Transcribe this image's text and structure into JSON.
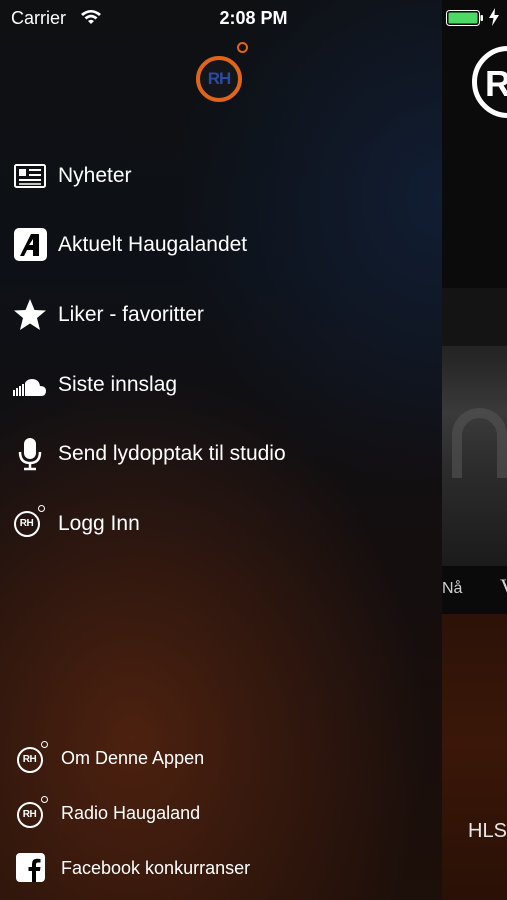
{
  "status_bar": {
    "carrier": "Carrier",
    "time": "2:08 PM",
    "battery_color": "#4cd964"
  },
  "menu": {
    "logo_text": "RH",
    "accent": "#e06518",
    "items": [
      {
        "label": "Nyheter",
        "icon": "newspaper-icon"
      },
      {
        "label": "Aktuelt Haugalandet",
        "icon": "a-logo-icon"
      },
      {
        "label": "Liker - favoritter",
        "icon": "star-icon"
      },
      {
        "label": "Siste innslag",
        "icon": "soundcloud-icon"
      },
      {
        "label": "Send lydopptak til studio",
        "icon": "microphone-icon"
      },
      {
        "label": "Logg Inn",
        "icon": "rh-logo-icon"
      }
    ],
    "footer": [
      {
        "label": "Om Denne Appen",
        "icon": "rh-logo-icon"
      },
      {
        "label": "Radio Haugaland",
        "icon": "rh-logo-icon"
      },
      {
        "label": "Facebook konkurranser",
        "icon": "facebook-icon"
      }
    ]
  },
  "background_app": {
    "logo_text": "R",
    "tab_now": "Nå",
    "tab_next": "V",
    "stream_label": "HLS"
  }
}
